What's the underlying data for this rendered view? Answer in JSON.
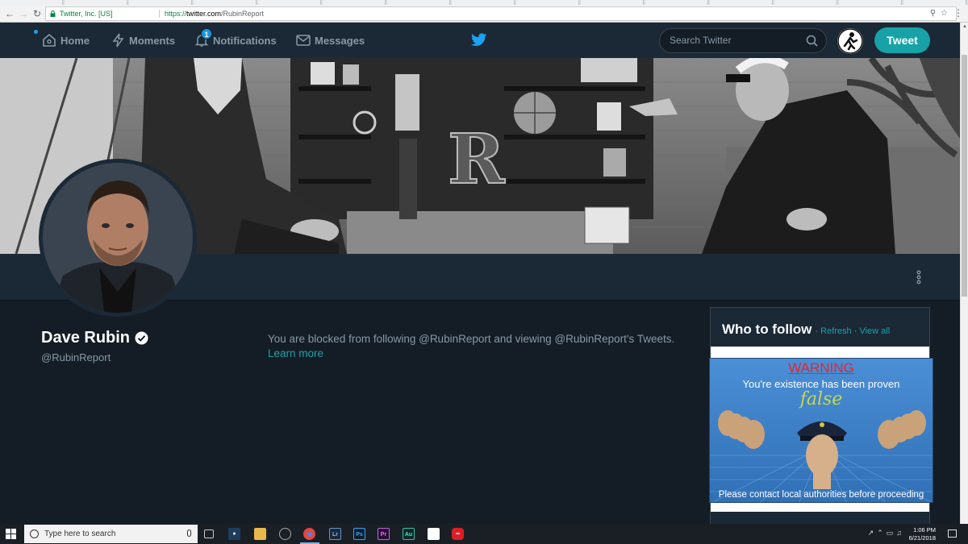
{
  "browser": {
    "secure_label": "Twitter, Inc. [US]",
    "url_scheme": "https://",
    "url_host": "twitter.com",
    "url_path": "/RubinReport"
  },
  "nav": {
    "home": "Home",
    "moments": "Moments",
    "notifications": "Notifications",
    "notifications_count": "1",
    "messages": "Messages",
    "search_placeholder": "Search Twitter",
    "tweet": "Tweet"
  },
  "profile": {
    "name": "Dave Rubin",
    "handle": "@RubinReport",
    "blocked_text": "You are blocked from following @RubinReport and viewing @RubinReport's Tweets.",
    "learn_more": "Learn more"
  },
  "who_to_follow": {
    "title": "Who to follow",
    "dot1": "·",
    "refresh": "Refresh",
    "dot2": "·",
    "view_all": "View all"
  },
  "overlay": {
    "warning": "WARNING",
    "line": "You're existence has been proven",
    "false_word": "false",
    "footer": "Please contact local authorities before proceeding"
  },
  "taskbar": {
    "search_placeholder": "Type here to search",
    "time": "1:06 PM",
    "date": "6/21/2018"
  },
  "colors": {
    "nav_bg": "#1b2836",
    "page_bg": "#141d26",
    "accent": "#17a2a8",
    "twitter_blue": "#1da1f2"
  }
}
